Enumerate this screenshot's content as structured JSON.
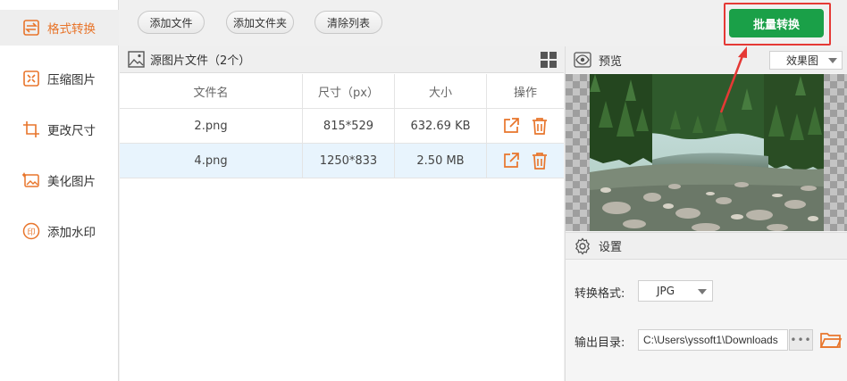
{
  "sidebar": {
    "items": [
      {
        "label": "格式转换",
        "icon": "swap-icon",
        "active": true
      },
      {
        "label": "压缩图片",
        "icon": "compress-icon",
        "active": false
      },
      {
        "label": "更改尺寸",
        "icon": "crop-icon",
        "active": false
      },
      {
        "label": "美化图片",
        "icon": "beautify-icon",
        "active": false
      },
      {
        "label": "添加水印",
        "icon": "watermark-icon",
        "active": false
      }
    ]
  },
  "toolbar": {
    "add_file": "添加文件",
    "add_folder": "添加文件夹",
    "clear_list": "清除列表",
    "batch_convert": "批量转换"
  },
  "file_panel": {
    "title": "源图片文件（2个）",
    "columns": [
      "文件名",
      "尺寸（px）",
      "大小",
      "操作"
    ],
    "rows": [
      {
        "name": "2.png",
        "dimensions": "815*529",
        "size": "632.69 KB",
        "selected": false
      },
      {
        "name": "4.png",
        "dimensions": "1250*833",
        "size": "2.50 MB",
        "selected": true
      }
    ]
  },
  "preview": {
    "title": "预览",
    "mode": "效果图"
  },
  "settings": {
    "title": "设置",
    "format_label": "转换格式:",
    "format_value": "JPG",
    "output_label": "输出目录:",
    "output_value": "C:\\Users\\yssoft1\\Downloads",
    "browse_label": "•••"
  },
  "colors": {
    "accent": "#e8752b",
    "batch_green": "#1aa048",
    "highlight_red": "#e53935",
    "selected_row": "#e8f4fd"
  }
}
